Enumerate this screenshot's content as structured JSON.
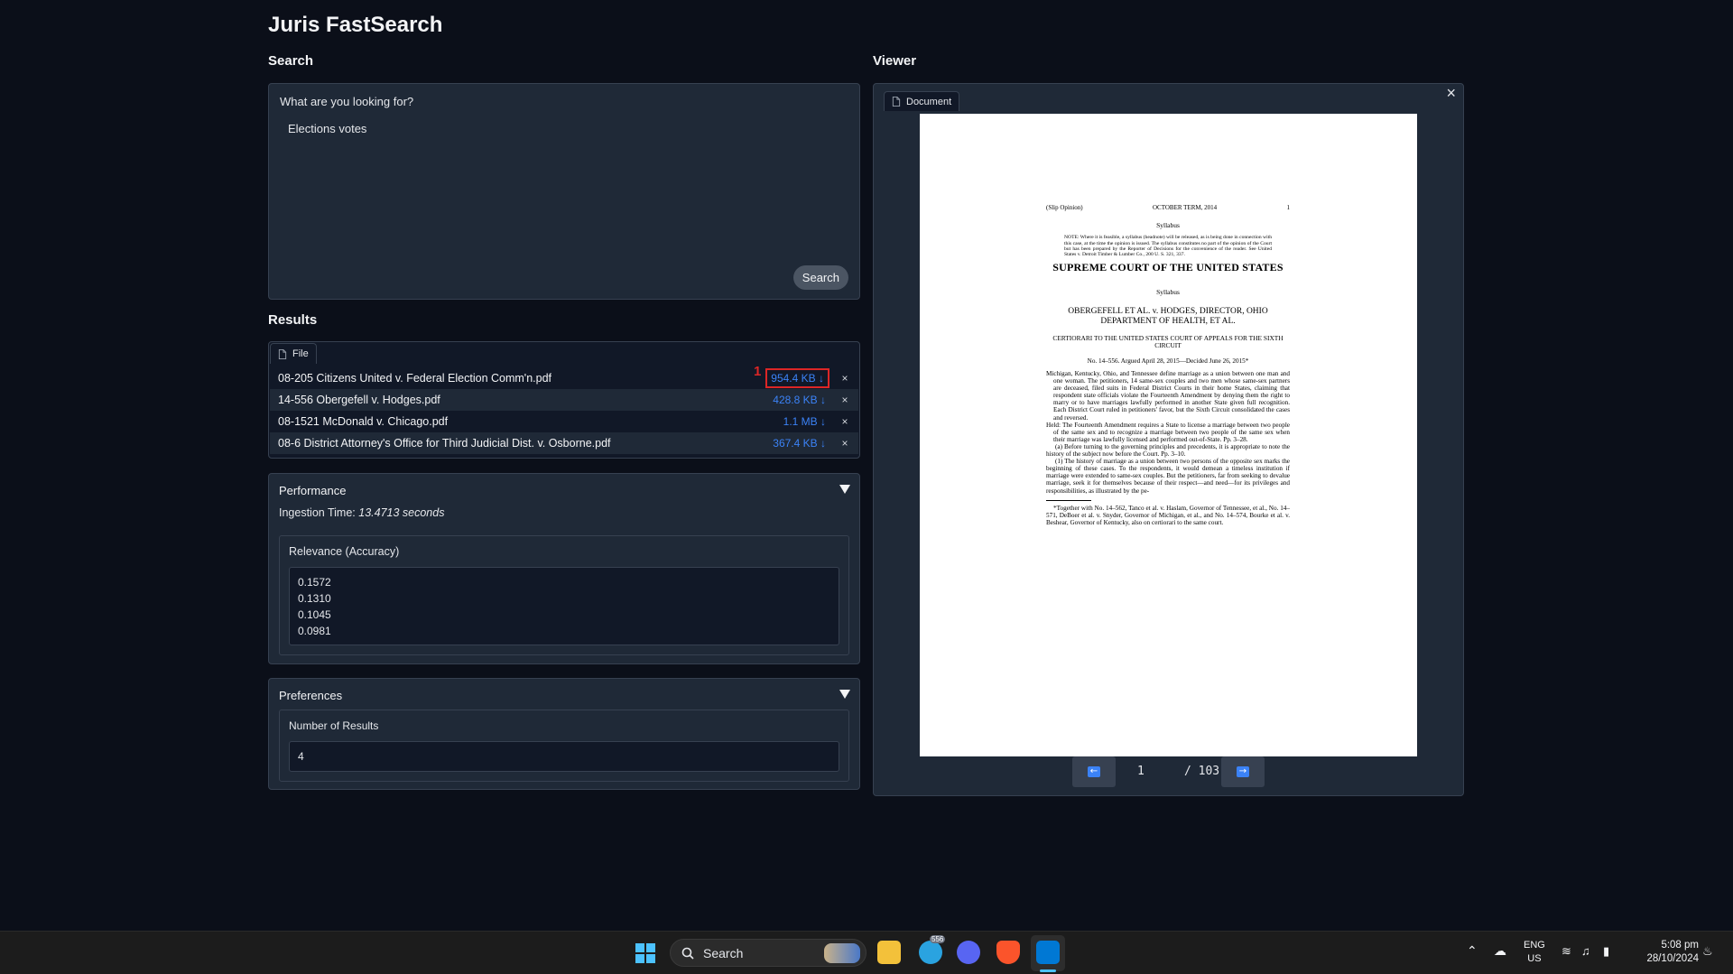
{
  "app": {
    "title": "Juris FastSearch"
  },
  "search": {
    "section_label": "Search",
    "prompt": "What are you looking for?",
    "query": "Elections votes",
    "button": "Search"
  },
  "results": {
    "section_label": "Results",
    "tab": "File",
    "files": [
      {
        "name": "08-205 Citizens United v. Federal Election Comm'n.pdf",
        "size": "954.4 KB ↓"
      },
      {
        "name": "14-556 Obergefell v. Hodges.pdf",
        "size": "428.8 KB ↓"
      },
      {
        "name": "08-1521 McDonald v. Chicago.pdf",
        "size": "1.1 MB ↓"
      },
      {
        "name": "08-6 District Attorney's Office for Third Judicial Dist. v. Osborne.pdf",
        "size": "367.4 KB ↓"
      }
    ],
    "annotation_number": "1",
    "remove_glyph": "×"
  },
  "performance": {
    "title": "Performance",
    "ingestion_label": "Ingestion Time:",
    "ingestion_value": "13.4713 seconds",
    "relevance_label": "Relevance (Accuracy)",
    "relevance_values": [
      "0.1572",
      "0.1310",
      "0.1045",
      "0.0981"
    ]
  },
  "preferences": {
    "title": "Preferences",
    "num_results_label": "Number of Results",
    "num_results": "4"
  },
  "viewer": {
    "section_label": "Viewer",
    "tab": "Document",
    "close_glyph": "×",
    "page_current": "1",
    "page_total": "/ 103",
    "prev_glyph": "←",
    "next_glyph": "→",
    "doc": {
      "slip": "(Slip Opinion)",
      "term": "OCTOBER TERM, 2014",
      "page_no": "1",
      "syllabus1": "Syllabus",
      "note": "NOTE: Where it is feasible, a syllabus (headnote) will be released, as is being done in connection with this case, at the time the opinion is issued. The syllabus constitutes no part of the opinion of the Court but has been prepared by the Reporter of Decisions for the convenience of the reader. See United States v. Detroit Timber & Lumber Co., 200 U. S. 321, 337.",
      "court": "SUPREME COURT OF THE UNITED STATES",
      "syllabus2": "Syllabus",
      "caption": "OBERGEFELL ET AL. v. HODGES, DIRECTOR, OHIO DEPARTMENT OF HEALTH, ET AL.",
      "certiorari": "CERTIORARI TO THE UNITED STATES COURT OF APPEALS FOR THE SIXTH CIRCUIT",
      "argued": "No. 14–556. Argued April 28, 2015—Decided June 26, 2015*",
      "p1": "Michigan, Kentucky, Ohio, and Tennessee define marriage as a union between one man and one woman. The petitioners, 14 same-sex couples and two men whose same-sex partners are deceased, filed suits in Federal District Courts in their home States, claiming that respondent state officials violate the Fourteenth Amendment by denying them the right to marry or to have marriages lawfully performed in another State given full recognition. Each District Court ruled in petitioners' favor, but the Sixth Circuit consolidated the cases and reversed.",
      "p2": "Held: The Fourteenth Amendment requires a State to license a marriage between two people of the same sex and to recognize a marriage between two people of the same sex when their marriage was lawfully licensed and performed out-of-State. Pp. 3–28.",
      "p3": "(a) Before turning to the governing principles and precedents, it is appropriate to note the history of the subject now before the Court. Pp. 3–10.",
      "p4": "(1) The history of marriage as a union between two persons of the opposite sex marks the beginning of these cases. To the respondents, it would demean a timeless institution if marriage were extended to same-sex couples. But the petitioners, far from seeking to devalue marriage, seek it for themselves because of their respect—and need—for its privileges and responsibilities, as illustrated by the pe-",
      "footnote": "*Together with No. 14–562, Tanco et al. v. Haslam, Governor of Tennessee, et al., No. 14–571, DeBoer et al. v. Snyder, Governor of Michigan, et al., and No. 14–574, Bourke et al. v. Beshear, Governor of Kentucky, also on certiorari to the same court."
    }
  },
  "taskbar": {
    "search": "Search",
    "lang_top": "ENG",
    "lang_bottom": "US",
    "time": "5:08 pm",
    "date": "28/10/2024",
    "telegram_badge": "556"
  },
  "colors": {
    "background": "#0b0f19",
    "panel": "#1f2937",
    "link": "#3b82f6",
    "highlight": "#dc2626"
  }
}
